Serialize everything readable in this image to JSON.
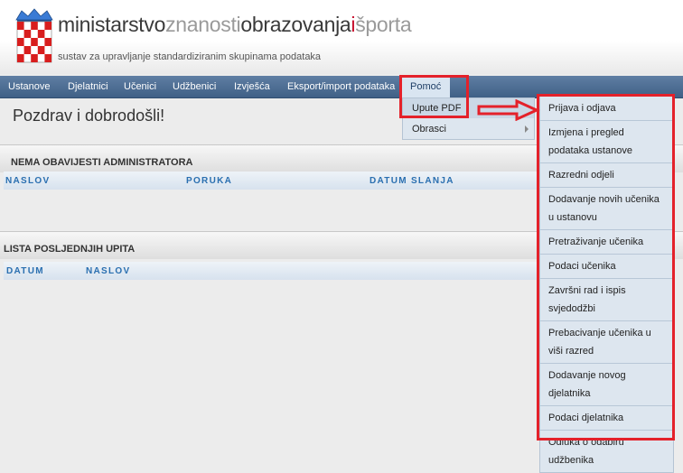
{
  "header": {
    "brand": {
      "part1": "ministarstvo",
      "part2": "znanosti",
      "part3": "obrazovanja",
      "part4": "i",
      "part5": "športa"
    },
    "tagline": "sustav za upravljanje standardiziranim skupinama podataka"
  },
  "nav": {
    "items": [
      {
        "label": "Ustanove"
      },
      {
        "label": "Djelatnici"
      },
      {
        "label": "Učenici"
      },
      {
        "label": "Udžbenici"
      },
      {
        "label": "Izvješća"
      },
      {
        "label": "Eksport/import podataka"
      },
      {
        "label": "Pomoć"
      }
    ]
  },
  "welcome": "Pozdrav i dobrodošli!",
  "notices": {
    "title": "NEMA OBAVIJESTI ADMINISTRATORA",
    "columns": [
      "NASLOV",
      "PORUKA",
      "DATUM SLANJA"
    ]
  },
  "queries": {
    "title": "LISTA POSLJEDNJIH UPITA",
    "columns": [
      "DATUM",
      "NASLOV"
    ]
  },
  "help_menu": {
    "items": [
      {
        "label": "Upute PDF"
      },
      {
        "label": "Obrasci"
      }
    ]
  },
  "submenu": {
    "items": [
      "Prijava i odjava",
      "Izmjena i pregled podataka ustanove",
      "Razredni odjeli",
      "Dodavanje novih učenika u ustanovu",
      "Pretraživanje učenika",
      "Podaci učenika",
      "Završni rad i ispis svjedodžbi",
      "Prebacivanje učenika u viši razred",
      "Dodavanje novog djelatnika",
      "Podaci djelatnika",
      "Odluka o odabiru udžbenika"
    ]
  },
  "colors": {
    "highlight": "#e4212a",
    "nav_bg": "#4d6d93",
    "column_header_text": "#2a6fb0",
    "brand_red": "#c8102e"
  }
}
